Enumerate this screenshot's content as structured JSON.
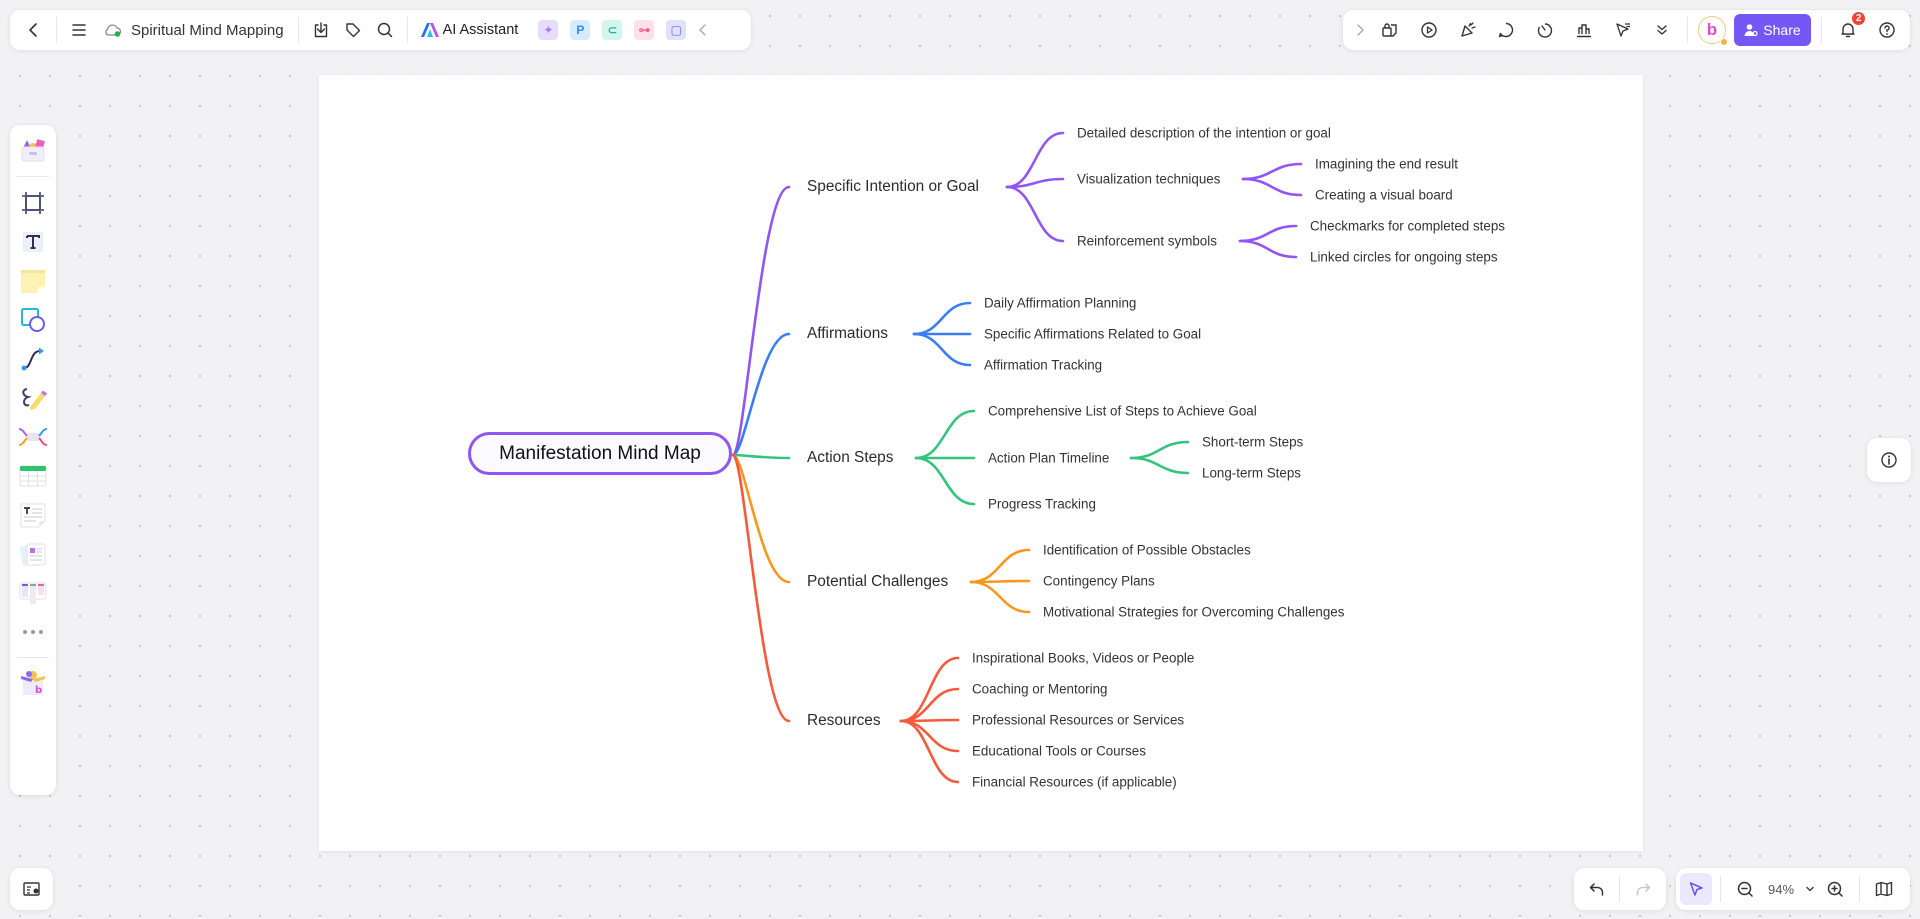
{
  "toolbar_left": {
    "back_icon": "chevron-left-icon",
    "menu_icon": "hamburger-menu-icon",
    "cloud_status_icon": "cloud-saved-icon",
    "document_title": "Spiritual Mind Mapping",
    "download_icon": "download-icon",
    "tag_icon": "tag-icon",
    "search_icon": "search-icon",
    "ai_assistant_label": "AI Assistant",
    "app_tiles": [
      {
        "name": "image-generator-icon",
        "glyph": "✦",
        "bg": "#e8dcfb",
        "fg": "#a87ef0"
      },
      {
        "name": "presentation-app-icon",
        "glyph": "P",
        "bg": "#d7ebfd",
        "fg": "#2f8bf0"
      },
      {
        "name": "mindmap-app-icon",
        "glyph": "⊂",
        "bg": "#d2f5ee",
        "fg": "#19b8a0"
      },
      {
        "name": "flowchart-app-icon",
        "glyph": "⊶",
        "bg": "#fde0ea",
        "fg": "#ee5a8c"
      },
      {
        "name": "chat-app-icon",
        "glyph": "▢",
        "bg": "#e1e1fb",
        "fg": "#6668ee"
      }
    ],
    "collapse_icon": "chevron-left-icon"
  },
  "toolbar_right": {
    "expand_icon": "chevron-right-icon",
    "tools": [
      "presentation-lock-icon",
      "play-icon",
      "celebrate-icon",
      "comment-icon",
      "timer-icon",
      "vote-chart-icon",
      "laser-pointer-icon",
      "more-chevron-icon"
    ],
    "avatar_letter": "b",
    "share_label": "Share",
    "notification_count": "2",
    "help_icon": "help-icon"
  },
  "left_rail": {
    "items": [
      "template-library-icon",
      "frame-icon",
      "text-icon",
      "sticky-note-icon",
      "shapes-icon",
      "connector-icon",
      "pen-icon",
      "mindmap-icon",
      "table-icon",
      "document-icon",
      "cards-icon",
      "kanban-icon",
      "more-icon",
      "plugins-icon"
    ]
  },
  "mindmap": {
    "root": "Manifestation Mind Map",
    "branches": [
      {
        "label": "Specific Intention or Goal",
        "color": "#9155f4",
        "children": [
          {
            "label": "Detailed description of the intention or goal",
            "children": []
          },
          {
            "label": "Visualization techniques",
            "children": [
              {
                "label": "Imagining the end result"
              },
              {
                "label": "Creating a visual board"
              }
            ]
          },
          {
            "label": "Reinforcement symbols",
            "children": [
              {
                "label": "Checkmarks for completed steps"
              },
              {
                "label": "Linked circles for ongoing steps"
              }
            ]
          }
        ]
      },
      {
        "label": "Affirmations",
        "color": "#3b7df5",
        "children": [
          {
            "label": "Daily Affirmation Planning",
            "children": []
          },
          {
            "label": "Specific Affirmations Related to Goal",
            "children": []
          },
          {
            "label": "Affirmation Tracking",
            "children": []
          }
        ]
      },
      {
        "label": "Action Steps",
        "color": "#34c47e",
        "children": [
          {
            "label": "Comprehensive List of Steps to Achieve Goal",
            "children": []
          },
          {
            "label": "Action Plan Timeline",
            "children": [
              {
                "label": "Short-term Steps"
              },
              {
                "label": "Long-term Steps"
              }
            ]
          },
          {
            "label": "Progress Tracking",
            "children": []
          }
        ]
      },
      {
        "label": "Potential Challenges",
        "color": "#f7981e",
        "children": [
          {
            "label": "Identification of Possible Obstacles",
            "children": []
          },
          {
            "label": "Contingency Plans",
            "children": []
          },
          {
            "label": "Motivational Strategies for Overcoming Challenges",
            "children": []
          }
        ]
      },
      {
        "label": "Resources",
        "color": "#f55a3a",
        "children": [
          {
            "label": "Inspirational Books, Videos or People",
            "children": []
          },
          {
            "label": "Coaching or Mentoring",
            "children": []
          },
          {
            "label": "Professional Resources or Services",
            "children": []
          },
          {
            "label": "Educational Tools or Courses",
            "children": []
          },
          {
            "label": "Financial Resources (if applicable)",
            "children": []
          }
        ]
      }
    ]
  },
  "bottom": {
    "zoom_level": "94%",
    "undo_icon": "undo-icon",
    "redo_icon": "redo-icon",
    "select_icon": "pointer-icon",
    "zoom_out_icon": "zoom-out-icon",
    "zoom_in_icon": "zoom-in-icon",
    "map_icon": "minimap-icon",
    "info_icon": "info-icon",
    "feedback_icon": "canvas-settings-icon"
  }
}
